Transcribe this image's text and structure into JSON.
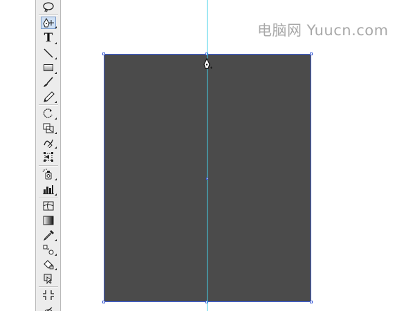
{
  "watermark": {
    "text": "电脑网 Yuucn.com"
  },
  "toolbar": {
    "tools": [
      {
        "name": "lasso-tool-icon"
      },
      {
        "name": "pen-tool-icon",
        "selected": true
      },
      {
        "name": "type-tool-icon",
        "label": "T"
      },
      {
        "name": "line-segment-tool-icon"
      },
      {
        "name": "rectangle-tool-icon"
      },
      {
        "name": "paintbrush-tool-icon"
      },
      {
        "name": "pencil-tool-icon"
      },
      {
        "name": "rotate-tool-icon"
      },
      {
        "name": "scale-tool-icon"
      },
      {
        "name": "warp-tool-icon"
      },
      {
        "name": "free-transform-tool-icon"
      },
      {
        "name": "symbol-sprayer-tool-icon"
      },
      {
        "name": "column-graph-tool-icon"
      },
      {
        "name": "mesh-tool-icon"
      },
      {
        "name": "gradient-tool-icon"
      },
      {
        "name": "eyedropper-tool-icon"
      },
      {
        "name": "blend-tool-icon"
      },
      {
        "name": "live-paint-bucket-tool-icon"
      },
      {
        "name": "live-paint-selection-tool-icon"
      },
      {
        "name": "crop-area-tool-icon"
      }
    ]
  },
  "canvas": {
    "rectangle_fill": "#4b4b4b",
    "selection_color": "#3f5fd6",
    "guide_color": "#43d0e8",
    "cursor": "pen-cursor-icon"
  }
}
